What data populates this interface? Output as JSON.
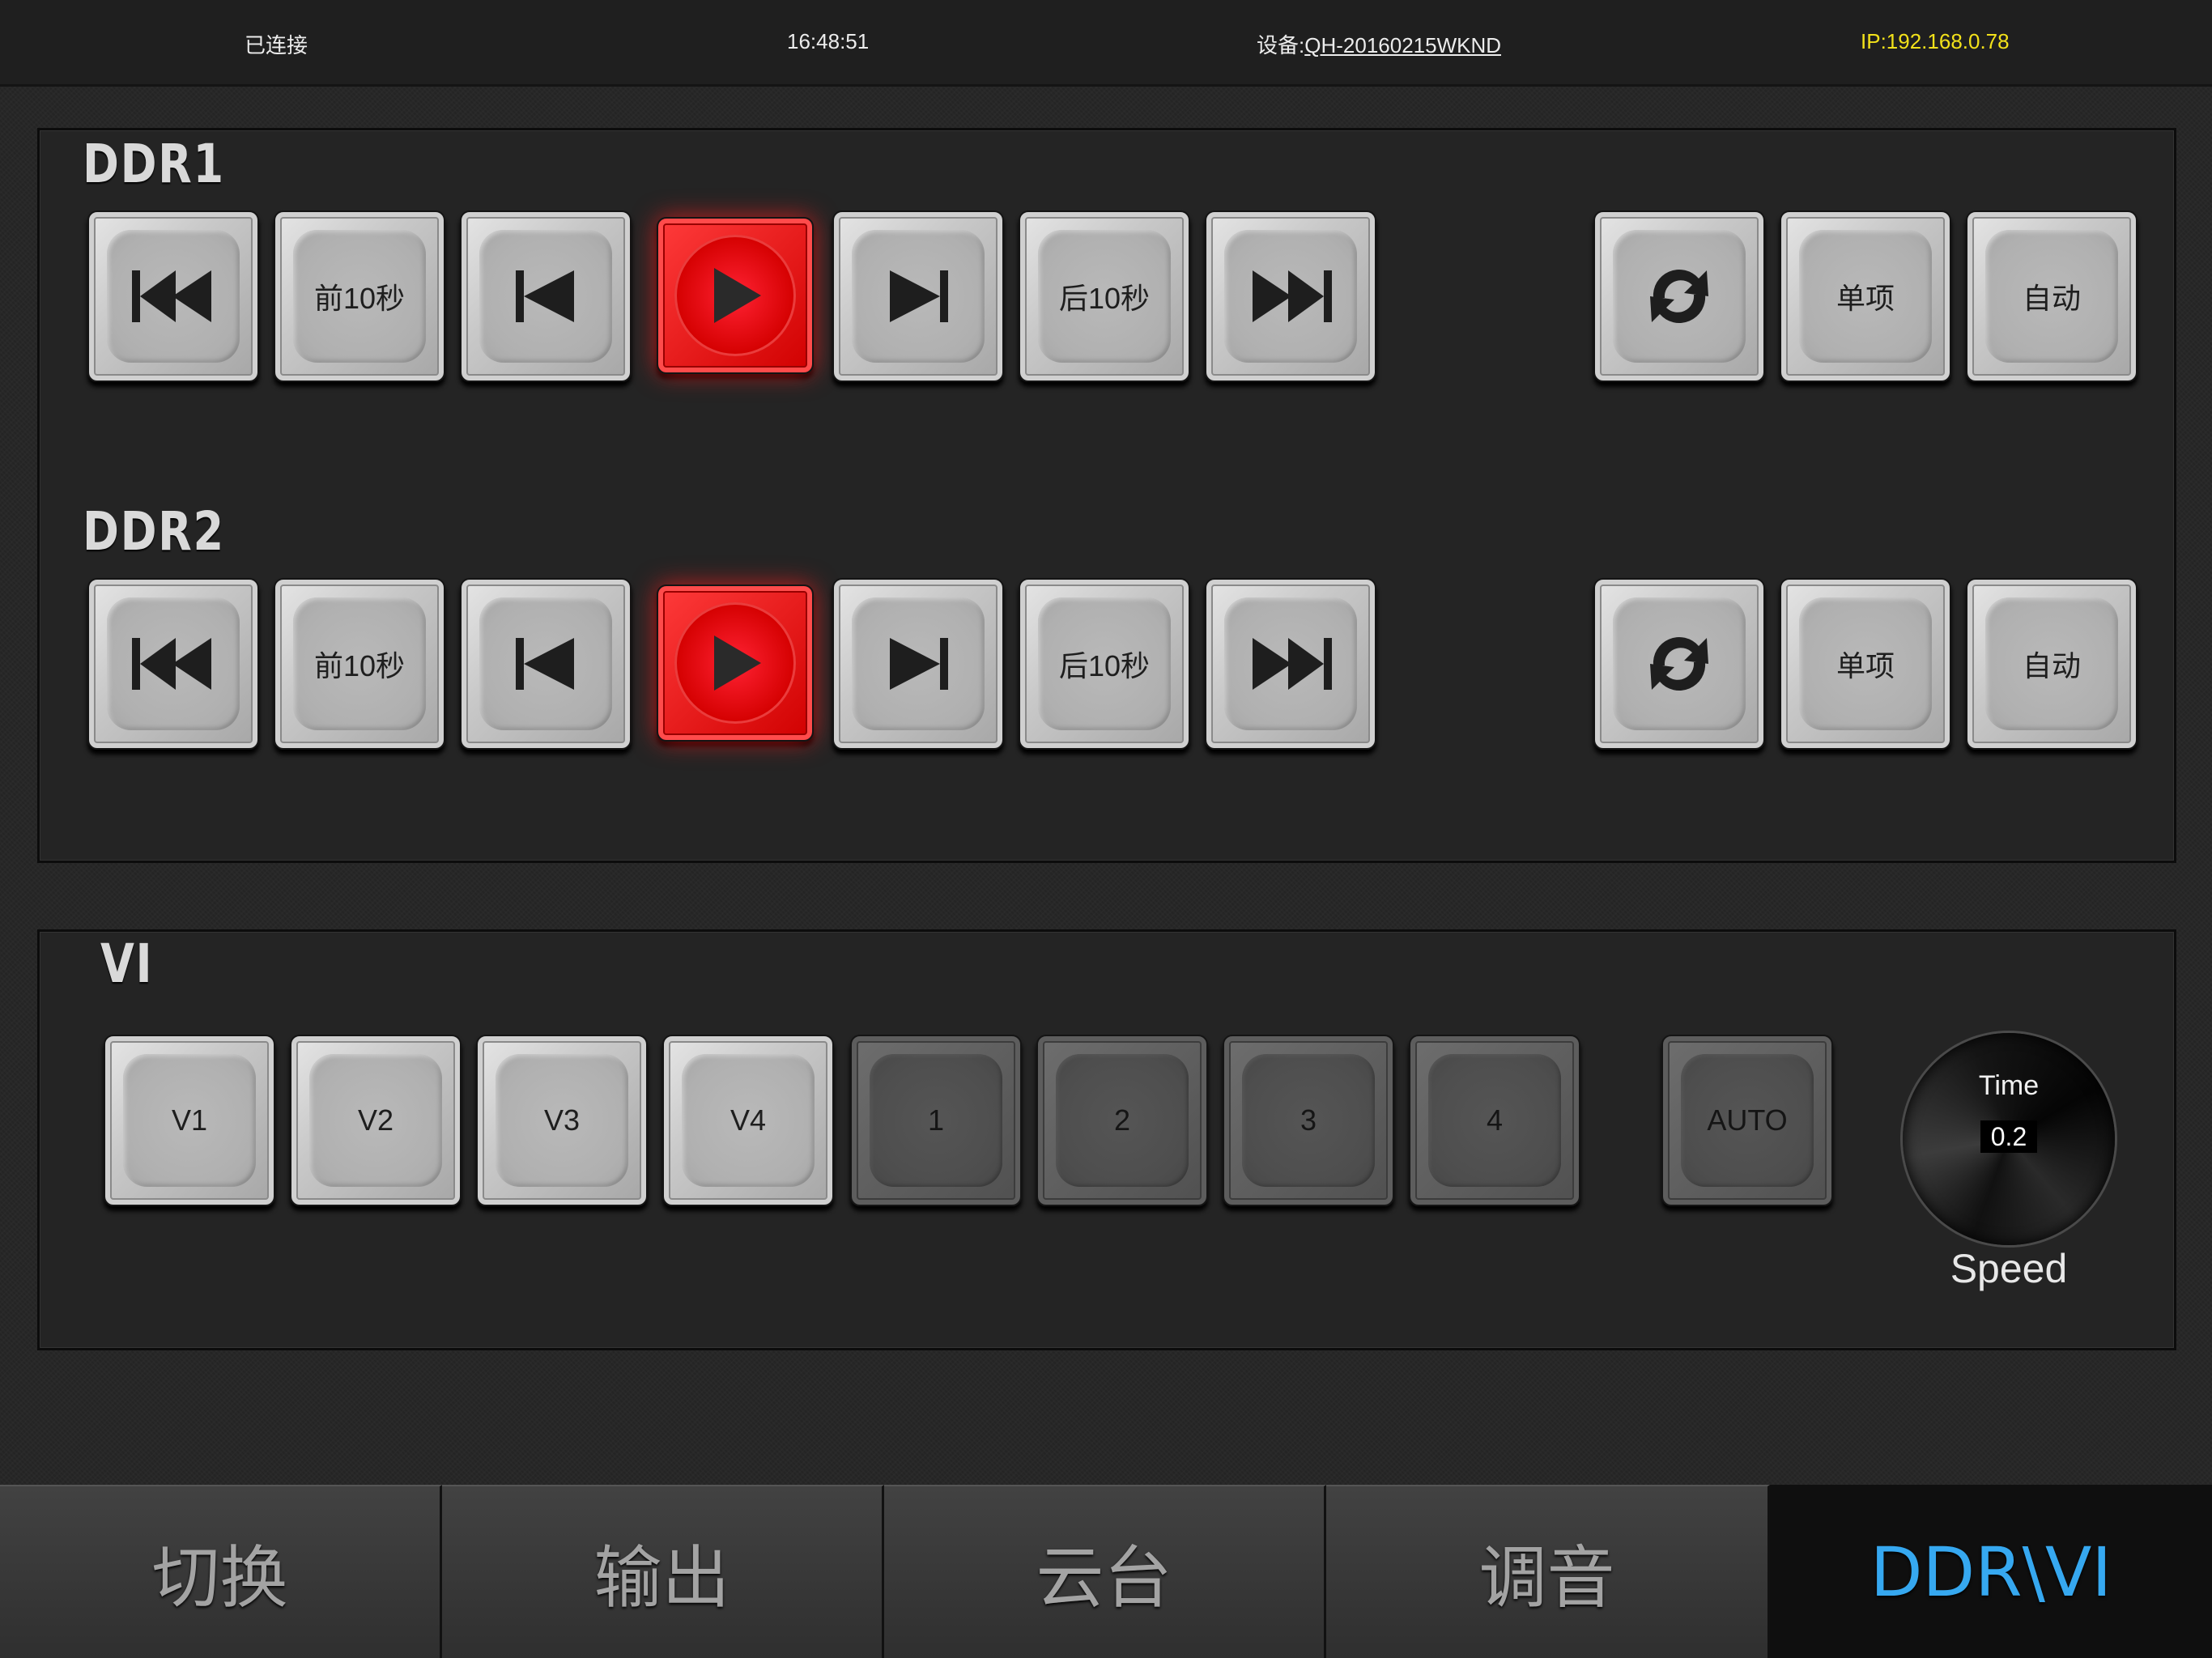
{
  "status_bar": {
    "connection": "已连接",
    "time": "16:48:51",
    "device_prefix": "设备:",
    "device_id": "QH-20160215WKND",
    "ip": "IP:192.168.0.78",
    "ip_color": "#f2e11a"
  },
  "ddr_panel": {
    "rows": [
      {
        "title": "DDR1",
        "buttons": [
          {
            "icon": "skip-to-start-icon",
            "label": ""
          },
          {
            "label": "前10秒"
          },
          {
            "icon": "previous-icon",
            "label": ""
          },
          {
            "icon": "play-icon",
            "label": "",
            "state": "active-red"
          },
          {
            "icon": "next-icon",
            "label": ""
          },
          {
            "label": "后10秒"
          },
          {
            "icon": "skip-to-end-icon",
            "label": ""
          },
          {
            "icon": "loop-icon",
            "label": ""
          },
          {
            "label": "单项"
          },
          {
            "label": "自动"
          }
        ]
      },
      {
        "title": "DDR2",
        "buttons": [
          {
            "icon": "skip-to-start-icon",
            "label": ""
          },
          {
            "label": "前10秒"
          },
          {
            "icon": "previous-icon",
            "label": ""
          },
          {
            "icon": "play-icon",
            "label": "",
            "state": "active-red"
          },
          {
            "icon": "next-icon",
            "label": ""
          },
          {
            "label": "后10秒"
          },
          {
            "icon": "skip-to-end-icon",
            "label": ""
          },
          {
            "icon": "loop-icon",
            "label": ""
          },
          {
            "label": "单项"
          },
          {
            "label": "自动"
          }
        ]
      }
    ]
  },
  "vi_panel": {
    "title": "VI",
    "buttons": [
      {
        "label": "V1",
        "state": "light"
      },
      {
        "label": "V2",
        "state": "light"
      },
      {
        "label": "V3",
        "state": "light"
      },
      {
        "label": "V4",
        "state": "light"
      },
      {
        "label": "1",
        "state": "dark"
      },
      {
        "label": "2",
        "state": "dark"
      },
      {
        "label": "3",
        "state": "dark"
      },
      {
        "label": "4",
        "state": "dark"
      },
      {
        "label": "AUTO",
        "state": "dark"
      }
    ],
    "dial": {
      "time_label": "Time",
      "value": "0.2",
      "speed_label": "Speed"
    }
  },
  "tabs": [
    {
      "label": "切换"
    },
    {
      "label": "输出"
    },
    {
      "label": "云台"
    },
    {
      "label": "调音"
    },
    {
      "label": "DDR\\VI",
      "active": true
    }
  ],
  "colors": {
    "active_tab_text": "#36a8f0",
    "play_active": "#e00000",
    "background": "#262626"
  }
}
